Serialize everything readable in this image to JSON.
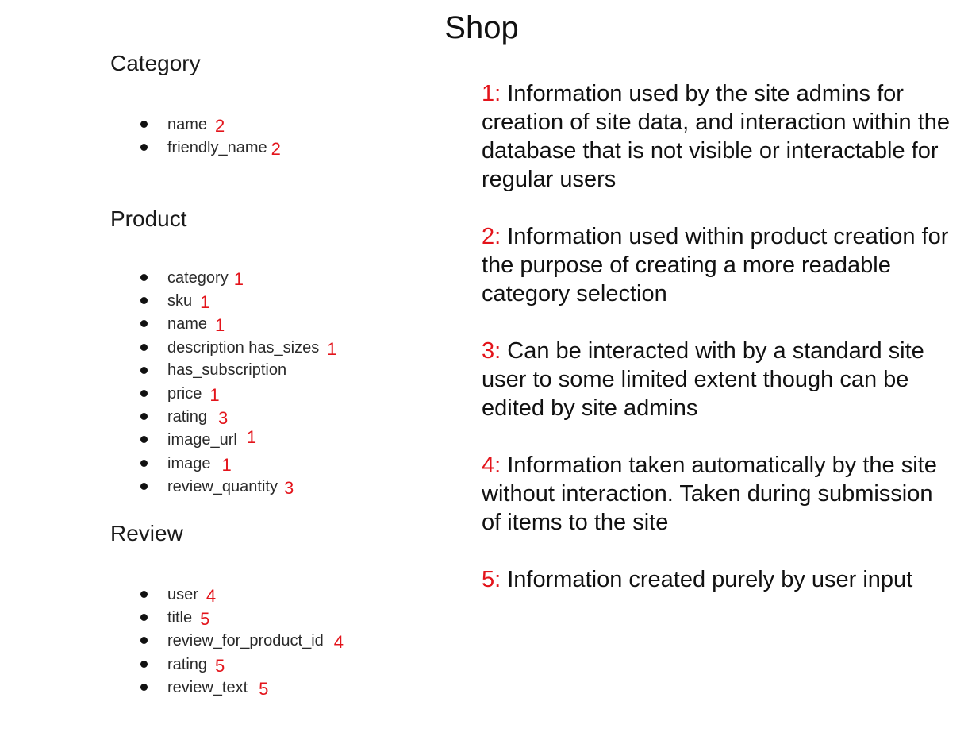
{
  "title": "Shop",
  "models": [
    {
      "heading": "Category",
      "fields": [
        {
          "name": "name",
          "tag": "2"
        },
        {
          "name": "friendly_name",
          "tag": "2"
        }
      ]
    },
    {
      "heading": "Product",
      "fields": [
        {
          "name": "category",
          "tag": "1"
        },
        {
          "name": "sku",
          "tag": "1"
        },
        {
          "name": "name",
          "tag": "1"
        },
        {
          "name": "description has_sizes",
          "tag": "1"
        },
        {
          "name": "has_subscription",
          "tag": ""
        },
        {
          "name": "price",
          "tag": "1"
        },
        {
          "name": "rating",
          "tag": "3"
        },
        {
          "name": "image_url",
          "tag": "1"
        },
        {
          "name": "image",
          "tag": "1"
        },
        {
          "name": "review_quantity",
          "tag": "3"
        }
      ]
    },
    {
      "heading": "Review",
      "fields": [
        {
          "name": "user",
          "tag": "4"
        },
        {
          "name": "title",
          "tag": "5"
        },
        {
          "name": "review_for_product_id",
          "tag": "4"
        },
        {
          "name": "rating",
          "tag": "5"
        },
        {
          "name": "review_text",
          "tag": "5"
        }
      ]
    }
  ],
  "legend": [
    {
      "key": "1:",
      "text": "Information used by the site admins for creation of site data, and interaction within the database that is not visible or interactable for regular users"
    },
    {
      "key": "2:",
      "text": "Information used within product creation for the purpose of creating a more readable category selection"
    },
    {
      "key": "3:",
      "text": "Can be interacted with by a standard site user to some limited extent though can be edited by site admins"
    },
    {
      "key": "4:",
      "text": "Information taken automatically by the site without interaction. Taken during submission of items to the site"
    },
    {
      "key": "5:",
      "text": "Information created purely by user input"
    }
  ],
  "colors": {
    "tag": "#e3141b",
    "text": "#1a1a1a",
    "background": "#ffffff"
  }
}
